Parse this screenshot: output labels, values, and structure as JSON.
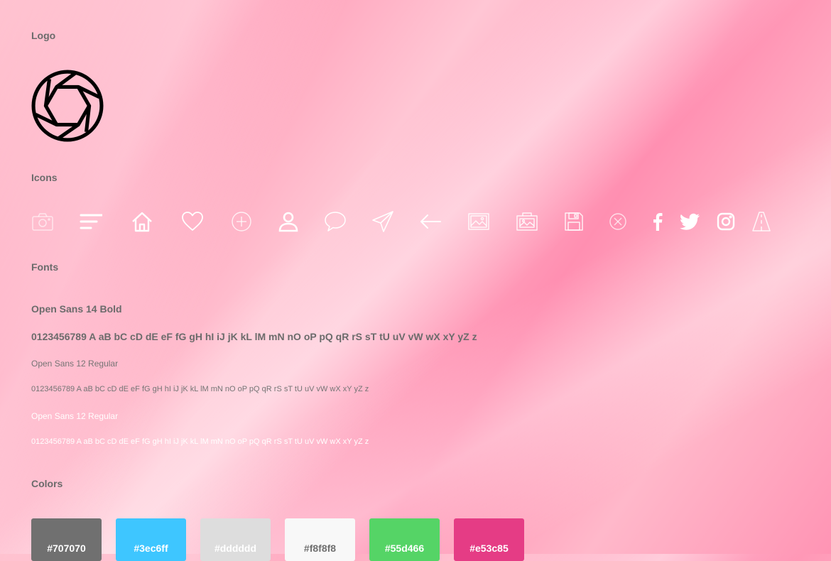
{
  "sections": {
    "logo": "Logo",
    "icons": "Icons",
    "fonts": "Fonts",
    "colors": "Colors"
  },
  "icons": [
    "camera-icon",
    "menu-icon",
    "home-icon",
    "heart-icon",
    "plus-circle-icon",
    "user-icon",
    "chat-bubble-icon",
    "send-icon",
    "arrow-left-icon",
    "image-icon",
    "photo-camera-icon",
    "save-icon",
    "close-circle-icon",
    "facebook-icon",
    "twitter-icon",
    "instagram-icon",
    "road-icon"
  ],
  "fonts": {
    "bold_label": "Open Sans 14 Bold",
    "bold_sample": "0123456789 A aB bC cD dE eF fG gH hI iJ jK kL lM mN nO oP pQ qR rS sT tU uV vW wX xY yZ z",
    "regular_label_dark": "Open Sans 12 Regular",
    "regular_sample_dark": "0123456789 A aB bC cD dE eF fG gH hI iJ jK kL lM mN nO oP pQ qR rS sT tU uV vW wX xY yZ z",
    "regular_label_light": "Open Sans 12 Regular",
    "regular_sample_light": "0123456789 A aB bC cD dE eF fG gH hI iJ jK kL lM mN nO oP pQ qR rS sT tU uV vW wX xY yZ z"
  },
  "colors": [
    {
      "label": "#707070",
      "hex": "#707070"
    },
    {
      "label": "#3ec6ff",
      "hex": "#3ec6ff"
    },
    {
      "label": "#dddddd",
      "hex": "#dddddd"
    },
    {
      "label": "#f8f8f8",
      "hex": "#f8f8f8"
    },
    {
      "label": "#55d466",
      "hex": "#55d466"
    },
    {
      "label": "#e53c85",
      "hex": "#e53c85"
    }
  ]
}
